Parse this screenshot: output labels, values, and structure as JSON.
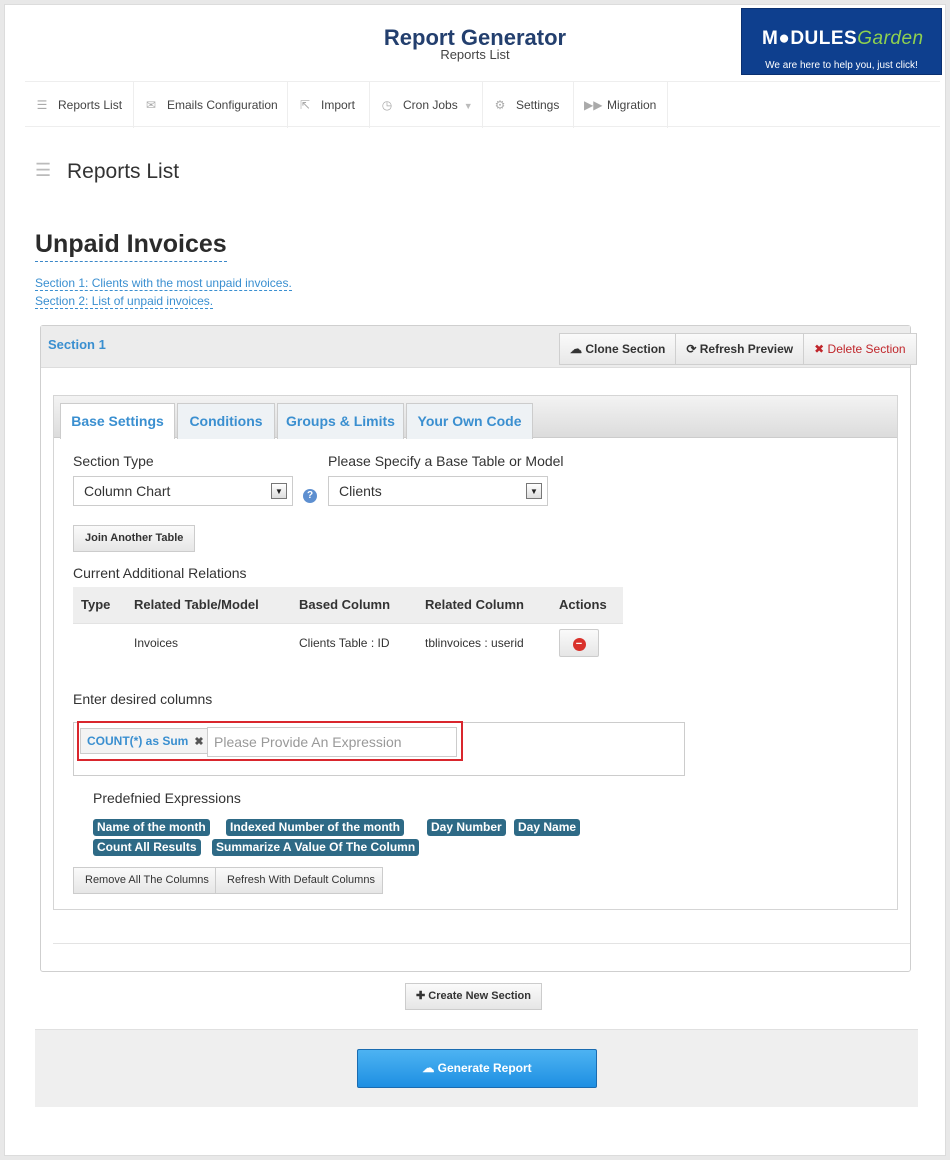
{
  "header": {
    "title": "Report Generator",
    "subtitle": "Reports List",
    "logo": {
      "name_a": "M",
      "name_b": "DULES",
      "name_c": "Garden",
      "tagline": "We are here to help you, just click!"
    }
  },
  "nav": {
    "items": [
      {
        "label": "Reports List",
        "icon": "list-icon"
      },
      {
        "label": "Emails Configuration",
        "icon": "envelope-icon"
      },
      {
        "label": "Import",
        "icon": "import-icon"
      },
      {
        "label": "Cron Jobs",
        "icon": "clock-icon"
      },
      {
        "label": "Settings",
        "icon": "cogs-icon"
      },
      {
        "label": "Migration",
        "icon": "forward-icon"
      }
    ]
  },
  "page": {
    "heading": "Reports List",
    "report_title": "Unpaid Invoices",
    "section_links": [
      "Section 1: Clients with the most unpaid invoices.",
      "Section 2: List of unpaid invoices."
    ]
  },
  "section": {
    "title": "Section 1",
    "buttons": {
      "clone": "Clone Section",
      "refresh": "Refresh Preview",
      "delete": "Delete Section"
    },
    "tabs": [
      "Base Settings",
      "Conditions",
      "Groups & Limits",
      "Your Own Code"
    ],
    "section_type_label": "Section Type",
    "section_type_value": "Column Chart",
    "base_table_label": "Please Specify a Base Table or Model",
    "base_table_value": "Clients",
    "join_button": "Join Another Table",
    "relations_label": "Current Additional Relations",
    "relations_headers": [
      "Type",
      "Related Table/Model",
      "Based Column",
      "Related Column",
      "Actions"
    ],
    "relations_rows": [
      {
        "type": "",
        "related": "Invoices",
        "based": "Clients Table : ID",
        "related_column": "tblinvoices : userid"
      }
    ],
    "columns_label": "Enter desired columns",
    "column_tag": "COUNT(*) as Sum",
    "expression_placeholder": "Please Provide An Expression",
    "predefined_label": "Predefnied Expressions",
    "predefined": [
      "Name of the month",
      "Indexed Number of the month",
      "Day Number",
      "Day Name",
      "Count All Results",
      "Summarize A Value Of The Column"
    ],
    "remove_all_button": "Remove All The Columns",
    "refresh_default_button": "Refresh With Default Columns"
  },
  "actions": {
    "create_section": "Create New Section",
    "generate_report": "Generate Report"
  },
  "colors": {
    "accent": "#3a8fd0",
    "title": "#233f6e",
    "pill": "#2e6a86",
    "highlight": "#d9262d"
  }
}
